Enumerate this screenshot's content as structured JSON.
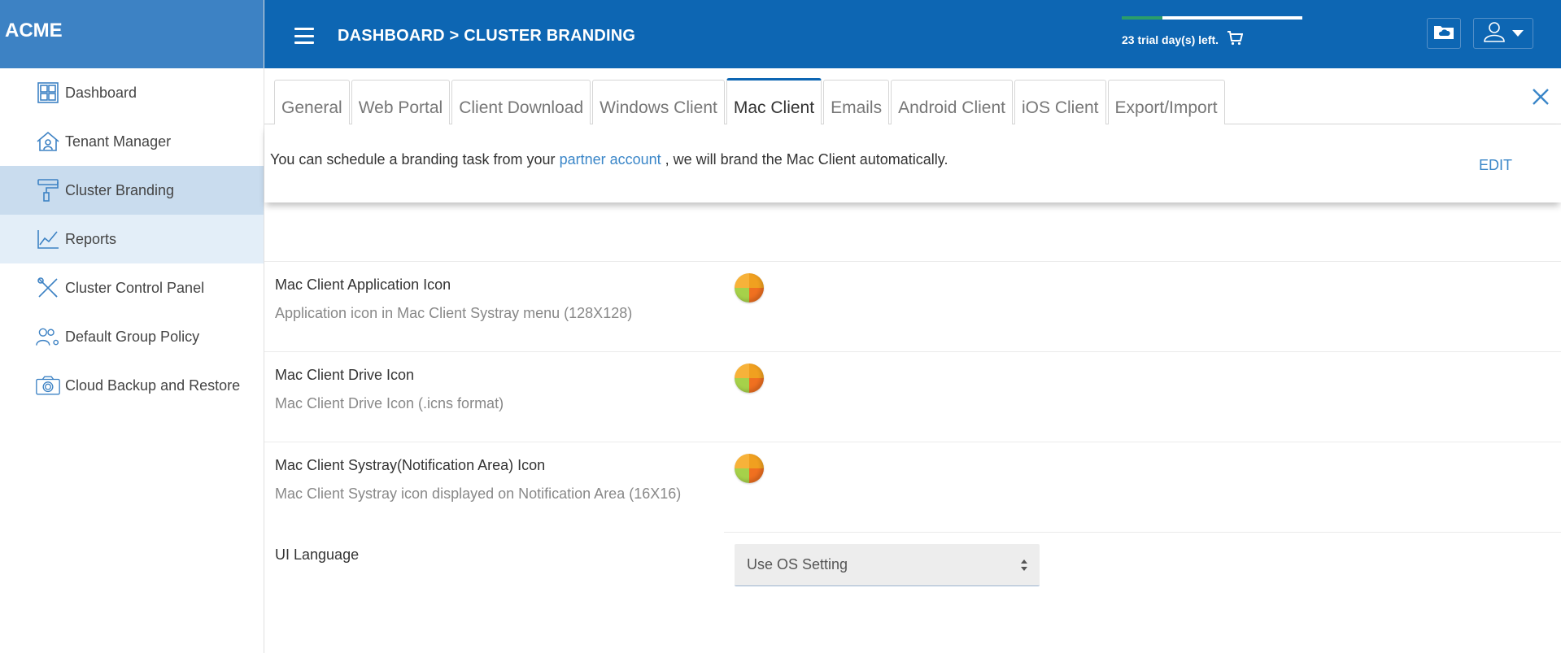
{
  "brand": "ACME",
  "sidebar": {
    "items": [
      {
        "label": "Dashboard",
        "icon": "dashboard-grid-icon"
      },
      {
        "label": "Tenant Manager",
        "icon": "tenant-house-icon"
      },
      {
        "label": "Cluster Branding",
        "icon": "paint-roller-icon"
      },
      {
        "label": "Reports",
        "icon": "line-chart-icon"
      },
      {
        "label": "Cluster Control Panel",
        "icon": "tools-icon"
      },
      {
        "label": "Default Group Policy",
        "icon": "users-gear-icon"
      },
      {
        "label": "Cloud Backup and Restore",
        "icon": "camera-icon"
      }
    ]
  },
  "header": {
    "breadcrumb": "DASHBOARD > CLUSTER BRANDING",
    "trial_text": "23 trial day(s) left.",
    "colors": {
      "header": "#0d66b3",
      "brand": "#3d82c4"
    }
  },
  "tabs": [
    "General",
    "Web Portal",
    "Client Download",
    "Windows Client",
    "Mac Client",
    "Emails",
    "Android Client",
    "iOS Client",
    "Export/Import"
  ],
  "info": {
    "text_before": "You can schedule a branding task from your ",
    "link": "partner account",
    "text_after": " , we will brand the Mac Client automatically.",
    "edit": "EDIT"
  },
  "settings": {
    "app_icon": {
      "title": "Mac Client Application Icon",
      "subtitle": "Application icon in Mac Client Systray menu (128X128)"
    },
    "drive_icon": {
      "title": "Mac Client Drive Icon",
      "subtitle": "Mac Client Drive Icon (.icns format)"
    },
    "systray_icon": {
      "title": "Mac Client Systray(Notification Area) Icon",
      "subtitle": "Mac Client Systray icon displayed on Notification Area (16X16)"
    },
    "ui_language": {
      "title": "UI Language",
      "value": "Use OS Setting"
    }
  }
}
